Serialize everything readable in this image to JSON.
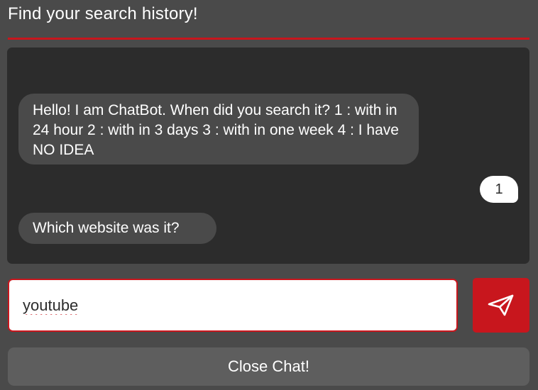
{
  "header": {
    "title": "Find your search history!"
  },
  "messages": [
    {
      "sender": "bot",
      "text": "Hello! I am ChatBot. When did you search it? 1 : with in 24 hour 2 : with in 3 days 3 : with in one week 4 : I have NO IDEA"
    },
    {
      "sender": "user",
      "text": "1"
    },
    {
      "sender": "bot",
      "text": "Which website was it?"
    }
  ],
  "input": {
    "value": "youtube"
  },
  "send_button": {
    "icon": "paper-plane-icon"
  },
  "close_button": {
    "label": "Close Chat!"
  },
  "colors": {
    "accent": "#c8161d",
    "background": "#4a4a4a",
    "chat_background": "#2c2c2c",
    "bot_bubble": "#4a4a4a",
    "user_bubble": "#ffffff"
  }
}
